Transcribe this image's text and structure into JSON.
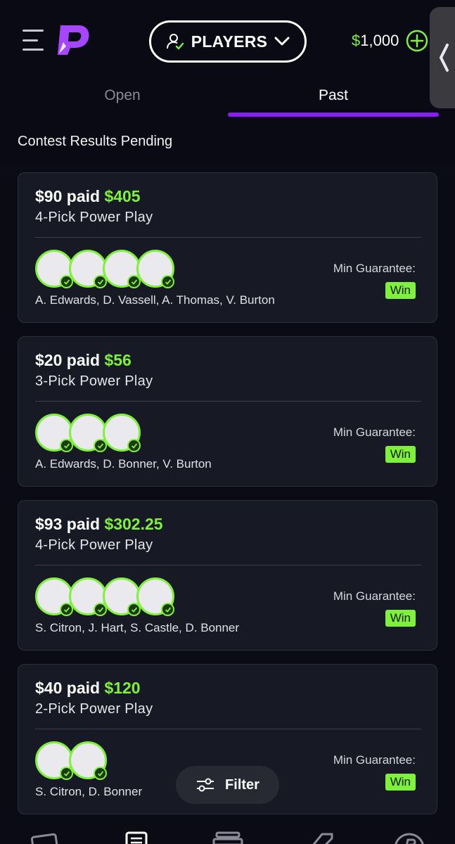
{
  "header": {
    "mode_label": "PLAYERS",
    "balance_currency": "$",
    "balance_amount": "1,000"
  },
  "tabs": [
    {
      "label": "Open",
      "active": false
    },
    {
      "label": "Past",
      "active": true
    }
  ],
  "section_title": "Contest Results Pending",
  "cards": [
    {
      "paid": "$90 paid",
      "won": "$405",
      "type": "4-Pick Power Play",
      "names": "A. Edwards, D. Vassell, A. Thomas, V. Burton",
      "guarantee_label": "Min Guarantee:",
      "result": "Win",
      "avatars": 4
    },
    {
      "paid": "$20 paid",
      "won": "$56",
      "type": "3-Pick Power Play",
      "names": "A. Edwards, D. Bonner, V. Burton",
      "guarantee_label": "Min Guarantee:",
      "result": "Win",
      "avatars": 3
    },
    {
      "paid": "$93 paid",
      "won": "$302.25",
      "type": "4-Pick Power Play",
      "names": "S. Citron, J. Hart, S. Castle, D. Bonner",
      "guarantee_label": "Min Guarantee:",
      "result": "Win",
      "avatars": 4
    },
    {
      "paid": "$40 paid",
      "won": "$120",
      "type": "2-Pick Power Play",
      "names": "S. Citron, D. Bonner",
      "guarantee_label": "Min Guarantee:",
      "result": "Win",
      "avatars": 2
    }
  ],
  "filter_label": "Filter",
  "colors": {
    "accent_green": "#7ef13a",
    "accent_purple": "#8a1cf5",
    "background": "#0b0b16",
    "card": "#171a24"
  },
  "icons": [
    "menu-icon",
    "app-logo",
    "player-icon",
    "chevron-down-icon",
    "add-funds-icon",
    "collapse-icon",
    "filter-icon",
    "bottom-nav-icons"
  ]
}
